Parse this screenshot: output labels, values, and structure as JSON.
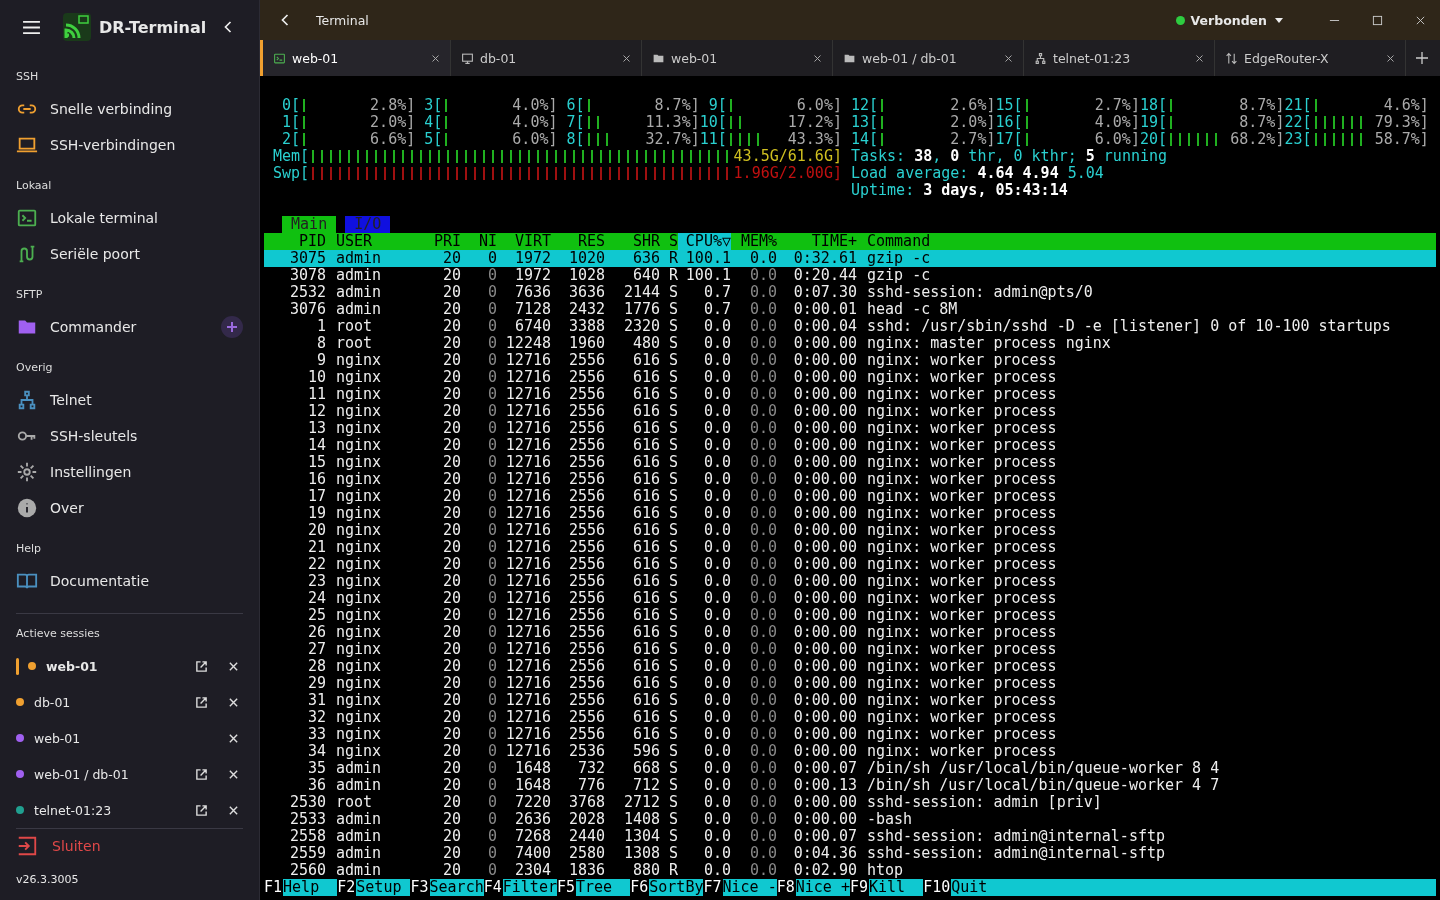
{
  "app": {
    "title": "DR-Terminal"
  },
  "sidebar": {
    "sections": [
      {
        "title": "SSH",
        "items": [
          {
            "label": "Snelle verbinding",
            "kind": "link"
          },
          {
            "label": "SSH-verbindingen",
            "kind": "laptop"
          }
        ]
      },
      {
        "title": "Lokaal",
        "items": [
          {
            "label": "Lokale terminal",
            "kind": "terminal"
          },
          {
            "label": "Seriële poort",
            "kind": "cable"
          }
        ]
      },
      {
        "title": "SFTP",
        "items": [
          {
            "label": "Commander",
            "kind": "folder",
            "add_button": true
          }
        ]
      },
      {
        "title": "Overig",
        "items": [
          {
            "label": "Telnet",
            "kind": "network"
          },
          {
            "label": "SSH-sleutels",
            "kind": "key"
          },
          {
            "label": "Instellingen",
            "kind": "gear"
          },
          {
            "label": "Over",
            "kind": "info"
          }
        ]
      },
      {
        "title": "Help",
        "items": [
          {
            "label": "Documentatie",
            "kind": "book"
          }
        ]
      }
    ],
    "sessions_title": "Actieve sessies",
    "sessions": [
      {
        "label": "web-01",
        "color": "#f0a030",
        "selected": true,
        "popout": true
      },
      {
        "label": "db-01",
        "color": "#f0a030",
        "selected": false,
        "popout": true
      },
      {
        "label": "web-01",
        "color": "#a060f0",
        "selected": false,
        "popout": false
      },
      {
        "label": "web-01 / db-01",
        "color": "#a060f0",
        "selected": false,
        "popout": true
      },
      {
        "label": "telnet-01:23",
        "color": "#20a090",
        "selected": false,
        "popout": true
      }
    ],
    "quit": "Sluiten",
    "version": "v26.3.3005"
  },
  "window": {
    "title": "Terminal",
    "status": "Verbonden",
    "connected": true
  },
  "tabs": [
    {
      "label": "web-01",
      "kind": "terminal",
      "selected": true
    },
    {
      "label": "db-01",
      "kind": "monitor",
      "selected": false
    },
    {
      "label": "web-01",
      "kind": "folder",
      "selected": false
    },
    {
      "label": "web-01 / db-01",
      "kind": "folder",
      "selected": false
    },
    {
      "label": "telnet-01:23",
      "kind": "network",
      "selected": false
    },
    {
      "label": "EdgeRouter-X",
      "kind": "router",
      "selected": false
    }
  ],
  "htop": {
    "cpus": [
      {
        "label": "0[",
        "reading": "2.8%]"
      },
      {
        "label": "1[",
        "reading": "2.0%]"
      },
      {
        "label": "2[",
        "reading": "6.6%]"
      },
      {
        "label": "3[",
        "reading": "4.0%]"
      },
      {
        "label": "4[",
        "reading": "4.0%]"
      },
      {
        "label": "5[",
        "reading": "6.0%]"
      },
      {
        "label": "6[",
        "reading": "8.7%]"
      },
      {
        "label": "7[",
        "reading": "11.3%]"
      },
      {
        "label": "8[",
        "reading": "32.7%]"
      },
      {
        "label": "9[",
        "reading": "6.0%]"
      },
      {
        "label": "10[",
        "reading": "17.2%]"
      },
      {
        "label": "11[",
        "reading": "43.3%]"
      },
      {
        "label": "12[",
        "reading": "2.6%]"
      },
      {
        "label": "13[",
        "reading": "2.0%]"
      },
      {
        "label": "14[",
        "reading": "2.7%]"
      },
      {
        "label": "15[",
        "reading": "2.7%]"
      },
      {
        "label": "16[",
        "reading": "4.0%]"
      },
      {
        "label": "17[",
        "reading": "6.0%]"
      },
      {
        "label": "18[",
        "reading": "8.7%]"
      },
      {
        "label": "19[",
        "reading": "8.7%]"
      },
      {
        "label": "20[",
        "reading": "68.2%]"
      },
      {
        "label": "21[",
        "reading": "4.6%]"
      },
      {
        "label": "22[",
        "reading": "79.3%]"
      },
      {
        "label": "23[",
        "reading": "58.7%]"
      }
    ],
    "memory": [
      {
        "label": "Mem[",
        "reading": "43.5G/61.6G]",
        "kind": "mem"
      },
      {
        "label": "Swp[",
        "reading": "1.96G/2.00G]",
        "kind": "swap"
      }
    ],
    "info": [
      "Tasks: **38**, **0** thr, 0 kthr; **5** running",
      "Load average: **4.64** **4.94** 5.04",
      "Uptime: **3 days, 05:43:14**"
    ],
    "views": [
      {
        "label": "Main",
        "selected": true
      },
      {
        "label": "I/O",
        "selected": false
      }
    ],
    "columns": [
      {
        "label": "PID",
        "sorted": false
      },
      {
        "label": "USER",
        "sorted": false
      },
      {
        "label": "PRI",
        "sorted": false
      },
      {
        "label": "NI",
        "sorted": false
      },
      {
        "label": "VIRT",
        "sorted": false
      },
      {
        "label": "RES",
        "sorted": false
      },
      {
        "label": "SHR",
        "sorted": false
      },
      {
        "label": "S",
        "sorted": false
      },
      {
        "label": "CPU%▽",
        "sorted": true
      },
      {
        "label": "MEM%",
        "sorted": false
      },
      {
        "label": "TIME+",
        "sorted": false
      },
      {
        "label": "Command",
        "sorted": false
      }
    ],
    "rows": [
      {
        "selected": true,
        "cells": [
          "3075",
          "admin",
          "20",
          "0",
          "1972",
          "1020",
          "636",
          "R",
          "100.1",
          "0.0",
          "0:32.61",
          "gzip -c"
        ]
      },
      {
        "selected": false,
        "cells": [
          "3078",
          "admin",
          "20",
          "0",
          "1972",
          "1028",
          "640",
          "R",
          "100.1",
          "0.0",
          "0:20.44",
          "gzip -c"
        ]
      },
      {
        "selected": false,
        "cells": [
          "2532",
          "admin",
          "20",
          "0",
          "7636",
          "3636",
          "2144",
          "S",
          "0.7",
          "0.0",
          "0:07.30",
          "sshd-session: admin@pts/0"
        ]
      },
      {
        "selected": false,
        "cells": [
          "3076",
          "admin",
          "20",
          "0",
          "7128",
          "2432",
          "1776",
          "S",
          "0.7",
          "0.0",
          "0:00.01",
          "head -c 8M"
        ]
      },
      {
        "selected": false,
        "cells": [
          "1",
          "root",
          "20",
          "0",
          "6740",
          "3388",
          "2320",
          "S",
          "0.0",
          "0.0",
          "0:00.04",
          "sshd: /usr/sbin/sshd -D -e [listener] 0 of 10-100 startups"
        ]
      },
      {
        "selected": false,
        "cells": [
          "8",
          "root",
          "20",
          "0",
          "12248",
          "1960",
          "480",
          "S",
          "0.0",
          "0.0",
          "0:00.00",
          "nginx: master process nginx"
        ]
      },
      {
        "selected": false,
        "cells": [
          "9",
          "nginx",
          "20",
          "0",
          "12716",
          "2556",
          "616",
          "S",
          "0.0",
          "0.0",
          "0:00.00",
          "nginx: worker process"
        ]
      },
      {
        "selected": false,
        "cells": [
          "10",
          "nginx",
          "20",
          "0",
          "12716",
          "2556",
          "616",
          "S",
          "0.0",
          "0.0",
          "0:00.00",
          "nginx: worker process"
        ]
      },
      {
        "selected": false,
        "cells": [
          "11",
          "nginx",
          "20",
          "0",
          "12716",
          "2556",
          "616",
          "S",
          "0.0",
          "0.0",
          "0:00.00",
          "nginx: worker process"
        ]
      },
      {
        "selected": false,
        "cells": [
          "12",
          "nginx",
          "20",
          "0",
          "12716",
          "2556",
          "616",
          "S",
          "0.0",
          "0.0",
          "0:00.00",
          "nginx: worker process"
        ]
      },
      {
        "selected": false,
        "cells": [
          "13",
          "nginx",
          "20",
          "0",
          "12716",
          "2556",
          "616",
          "S",
          "0.0",
          "0.0",
          "0:00.00",
          "nginx: worker process"
        ]
      },
      {
        "selected": false,
        "cells": [
          "14",
          "nginx",
          "20",
          "0",
          "12716",
          "2556",
          "616",
          "S",
          "0.0",
          "0.0",
          "0:00.00",
          "nginx: worker process"
        ]
      },
      {
        "selected": false,
        "cells": [
          "15",
          "nginx",
          "20",
          "0",
          "12716",
          "2556",
          "616",
          "S",
          "0.0",
          "0.0",
          "0:00.00",
          "nginx: worker process"
        ]
      },
      {
        "selected": false,
        "cells": [
          "16",
          "nginx",
          "20",
          "0",
          "12716",
          "2556",
          "616",
          "S",
          "0.0",
          "0.0",
          "0:00.00",
          "nginx: worker process"
        ]
      },
      {
        "selected": false,
        "cells": [
          "17",
          "nginx",
          "20",
          "0",
          "12716",
          "2556",
          "616",
          "S",
          "0.0",
          "0.0",
          "0:00.00",
          "nginx: worker process"
        ]
      },
      {
        "selected": false,
        "cells": [
          "19",
          "nginx",
          "20",
          "0",
          "12716",
          "2556",
          "616",
          "S",
          "0.0",
          "0.0",
          "0:00.00",
          "nginx: worker process"
        ]
      },
      {
        "selected": false,
        "cells": [
          "20",
          "nginx",
          "20",
          "0",
          "12716",
          "2556",
          "616",
          "S",
          "0.0",
          "0.0",
          "0:00.00",
          "nginx: worker process"
        ]
      },
      {
        "selected": false,
        "cells": [
          "21",
          "nginx",
          "20",
          "0",
          "12716",
          "2556",
          "616",
          "S",
          "0.0",
          "0.0",
          "0:00.00",
          "nginx: worker process"
        ]
      },
      {
        "selected": false,
        "cells": [
          "22",
          "nginx",
          "20",
          "0",
          "12716",
          "2556",
          "616",
          "S",
          "0.0",
          "0.0",
          "0:00.00",
          "nginx: worker process"
        ]
      },
      {
        "selected": false,
        "cells": [
          "23",
          "nginx",
          "20",
          "0",
          "12716",
          "2556",
          "616",
          "S",
          "0.0",
          "0.0",
          "0:00.00",
          "nginx: worker process"
        ]
      },
      {
        "selected": false,
        "cells": [
          "24",
          "nginx",
          "20",
          "0",
          "12716",
          "2556",
          "616",
          "S",
          "0.0",
          "0.0",
          "0:00.00",
          "nginx: worker process"
        ]
      },
      {
        "selected": false,
        "cells": [
          "25",
          "nginx",
          "20",
          "0",
          "12716",
          "2556",
          "616",
          "S",
          "0.0",
          "0.0",
          "0:00.00",
          "nginx: worker process"
        ]
      },
      {
        "selected": false,
        "cells": [
          "26",
          "nginx",
          "20",
          "0",
          "12716",
          "2556",
          "616",
          "S",
          "0.0",
          "0.0",
          "0:00.00",
          "nginx: worker process"
        ]
      },
      {
        "selected": false,
        "cells": [
          "27",
          "nginx",
          "20",
          "0",
          "12716",
          "2556",
          "616",
          "S",
          "0.0",
          "0.0",
          "0:00.00",
          "nginx: worker process"
        ]
      },
      {
        "selected": false,
        "cells": [
          "28",
          "nginx",
          "20",
          "0",
          "12716",
          "2556",
          "616",
          "S",
          "0.0",
          "0.0",
          "0:00.00",
          "nginx: worker process"
        ]
      },
      {
        "selected": false,
        "cells": [
          "29",
          "nginx",
          "20",
          "0",
          "12716",
          "2556",
          "616",
          "S",
          "0.0",
          "0.0",
          "0:00.00",
          "nginx: worker process"
        ]
      },
      {
        "selected": false,
        "cells": [
          "31",
          "nginx",
          "20",
          "0",
          "12716",
          "2556",
          "616",
          "S",
          "0.0",
          "0.0",
          "0:00.00",
          "nginx: worker process"
        ]
      },
      {
        "selected": false,
        "cells": [
          "32",
          "nginx",
          "20",
          "0",
          "12716",
          "2556",
          "616",
          "S",
          "0.0",
          "0.0",
          "0:00.00",
          "nginx: worker process"
        ]
      },
      {
        "selected": false,
        "cells": [
          "33",
          "nginx",
          "20",
          "0",
          "12716",
          "2556",
          "616",
          "S",
          "0.0",
          "0.0",
          "0:00.00",
          "nginx: worker process"
        ]
      },
      {
        "selected": false,
        "cells": [
          "34",
          "nginx",
          "20",
          "0",
          "12716",
          "2536",
          "596",
          "S",
          "0.0",
          "0.0",
          "0:00.00",
          "nginx: worker process"
        ]
      },
      {
        "selected": false,
        "cells": [
          "35",
          "admin",
          "20",
          "0",
          "1648",
          "732",
          "668",
          "S",
          "0.0",
          "0.0",
          "0:00.07",
          "/bin/sh /usr/local/bin/queue-worker 8 4"
        ]
      },
      {
        "selected": false,
        "cells": [
          "36",
          "admin",
          "20",
          "0",
          "1648",
          "776",
          "712",
          "S",
          "0.0",
          "0.0",
          "0:00.13",
          "/bin/sh /usr/local/bin/queue-worker 4 7"
        ]
      },
      {
        "selected": false,
        "cells": [
          "2530",
          "root",
          "20",
          "0",
          "7220",
          "3768",
          "2712",
          "S",
          "0.0",
          "0.0",
          "0:00.00",
          "sshd-session: admin [priv]"
        ]
      },
      {
        "selected": false,
        "cells": [
          "2533",
          "admin",
          "20",
          "0",
          "2636",
          "2028",
          "1408",
          "S",
          "0.0",
          "0.0",
          "0:00.00",
          "-bash"
        ]
      },
      {
        "selected": false,
        "cells": [
          "2558",
          "admin",
          "20",
          "0",
          "7268",
          "2440",
          "1304",
          "S",
          "0.0",
          "0.0",
          "0:00.07",
          "sshd-session: admin@internal-sftp"
        ]
      },
      {
        "selected": false,
        "cells": [
          "2559",
          "admin",
          "20",
          "0",
          "7400",
          "2580",
          "1308",
          "S",
          "0.0",
          "0.0",
          "0:04.36",
          "sshd-session: admin@internal-sftp"
        ]
      },
      {
        "selected": false,
        "cells": [
          "2560",
          "admin",
          "20",
          "0",
          "2304",
          "1836",
          "880",
          "R",
          "0.0",
          "0.0",
          "0:02.90",
          "htop"
        ]
      }
    ],
    "fkeys": [
      {
        "key": "F1",
        "label": "Help"
      },
      {
        "key": "F2",
        "label": "Setup"
      },
      {
        "key": "F3",
        "label": "Search"
      },
      {
        "key": "F4",
        "label": "Filter"
      },
      {
        "key": "F5",
        "label": "Tree"
      },
      {
        "key": "F6",
        "label": "SortBy"
      },
      {
        "key": "F7",
        "label": "Nice -"
      },
      {
        "key": "F8",
        "label": "Nice +"
      },
      {
        "key": "F9",
        "label": "Kill"
      },
      {
        "key": "F10",
        "label": "Quit"
      }
    ]
  }
}
